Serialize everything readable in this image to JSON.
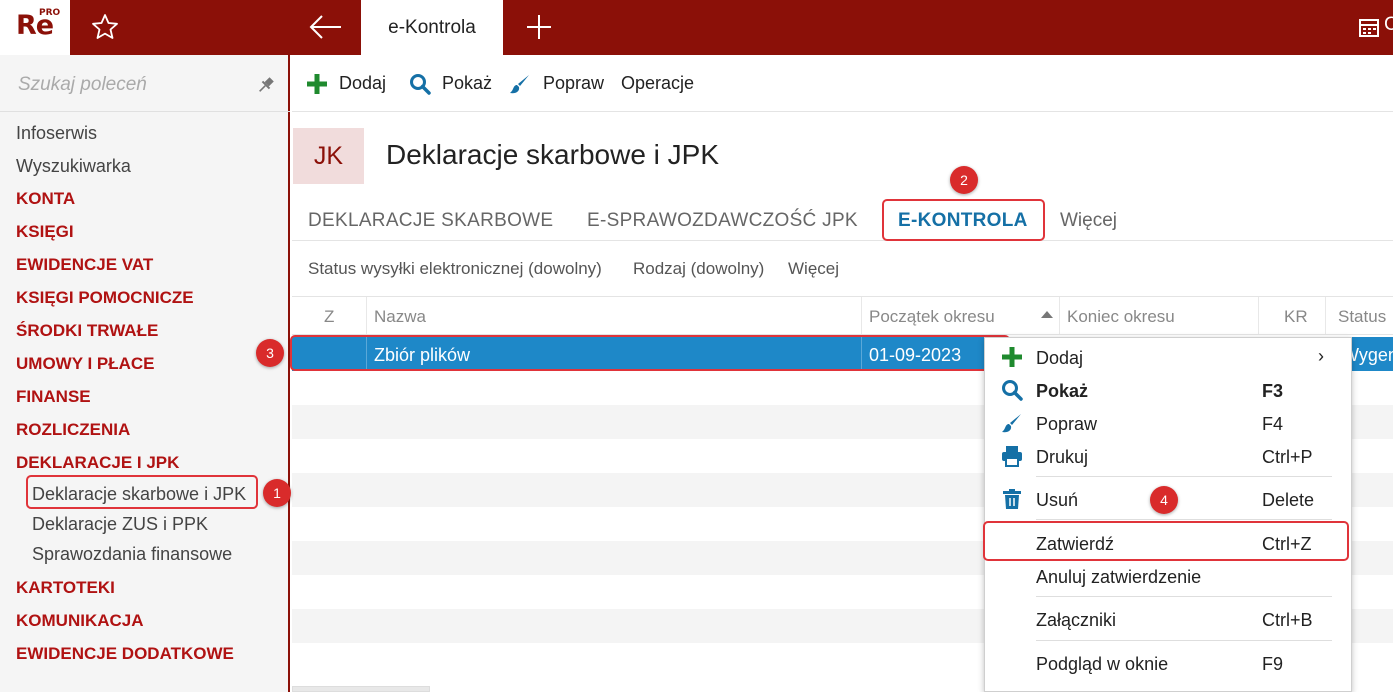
{
  "app": {
    "logo_text": "Re",
    "logo_badge": "PRO",
    "active_tab": "e-Kontrola",
    "calendar_fragment": "C"
  },
  "colors": {
    "brand": "#8b1008",
    "category": "#b01212",
    "selection": "#1e88c8",
    "active_tab": "#1570a6",
    "annotation": "#e0343a"
  },
  "sidebar": {
    "search_placeholder": "Szukaj poleceń",
    "items": [
      {
        "label": "Infoserwis",
        "kind": "plain"
      },
      {
        "label": "Wyszukiwarka",
        "kind": "plain"
      },
      {
        "label": "KONTA",
        "kind": "category"
      },
      {
        "label": "KSIĘGI",
        "kind": "category"
      },
      {
        "label": "EWIDENCJE VAT",
        "kind": "category"
      },
      {
        "label": "KSIĘGI POMOCNICZE",
        "kind": "category"
      },
      {
        "label": "ŚRODKI TRWAŁE",
        "kind": "category"
      },
      {
        "label": "UMOWY I PŁACE",
        "kind": "category"
      },
      {
        "label": "FINANSE",
        "kind": "category"
      },
      {
        "label": "ROZLICZENIA",
        "kind": "category"
      },
      {
        "label": "DEKLARACJE I JPK",
        "kind": "category"
      },
      {
        "label": "Deklaracje skarbowe i JPK",
        "kind": "sub"
      },
      {
        "label": "Deklaracje ZUS i PPK",
        "kind": "sub"
      },
      {
        "label": "Sprawozdania finansowe",
        "kind": "sub"
      },
      {
        "label": "KARTOTEKI",
        "kind": "category"
      },
      {
        "label": "KOMUNIKACJA",
        "kind": "category"
      },
      {
        "label": "EWIDENCJE DODATKOWE",
        "kind": "category"
      }
    ]
  },
  "toolbar": {
    "add": "Dodaj",
    "show": "Pokaż",
    "edit": "Popraw",
    "operations": "Operacje"
  },
  "page": {
    "badge": "JK",
    "title": "Deklaracje skarbowe i JPK"
  },
  "tabs": [
    "DEKLARACJE SKARBOWE",
    "E-SPRAWOZDAWCZOŚĆ JPK",
    "E-KONTROLA",
    "Więcej"
  ],
  "filters": [
    "Status wysyłki elektronicznej (dowolny)",
    "Rodzaj (dowolny)",
    "Więcej"
  ],
  "table": {
    "columns": [
      "Z",
      "Nazwa",
      "Początek okresu",
      "Koniec okresu",
      "KR",
      "Status"
    ],
    "rows": [
      {
        "z": "",
        "name": "Zbiór plików",
        "start": "01-09-2023",
        "status_fragment": "Wygen"
      }
    ]
  },
  "context_menu": {
    "items": [
      {
        "label": "Dodaj",
        "shortcut": "",
        "icon": "plus-icon",
        "submenu": true
      },
      {
        "label": "Pokaż",
        "shortcut": "F3",
        "icon": "search-icon",
        "bold": true
      },
      {
        "label": "Popraw",
        "shortcut": "F4",
        "icon": "brush-icon"
      },
      {
        "label": "Drukuj",
        "shortcut": "Ctrl+P",
        "icon": "printer-icon"
      },
      {
        "label": "Usuń",
        "shortcut": "Delete",
        "icon": "trash-icon"
      },
      {
        "label": "Zatwierdź",
        "shortcut": "Ctrl+Z",
        "icon": ""
      },
      {
        "label": "Anuluj zatwierdzenie",
        "shortcut": "",
        "icon": ""
      },
      {
        "label": "Załączniki",
        "shortcut": "Ctrl+B",
        "icon": ""
      },
      {
        "label": "Podgląd w oknie",
        "shortcut": "F9",
        "icon": ""
      }
    ]
  },
  "annotations": [
    "1",
    "2",
    "3",
    "4"
  ]
}
